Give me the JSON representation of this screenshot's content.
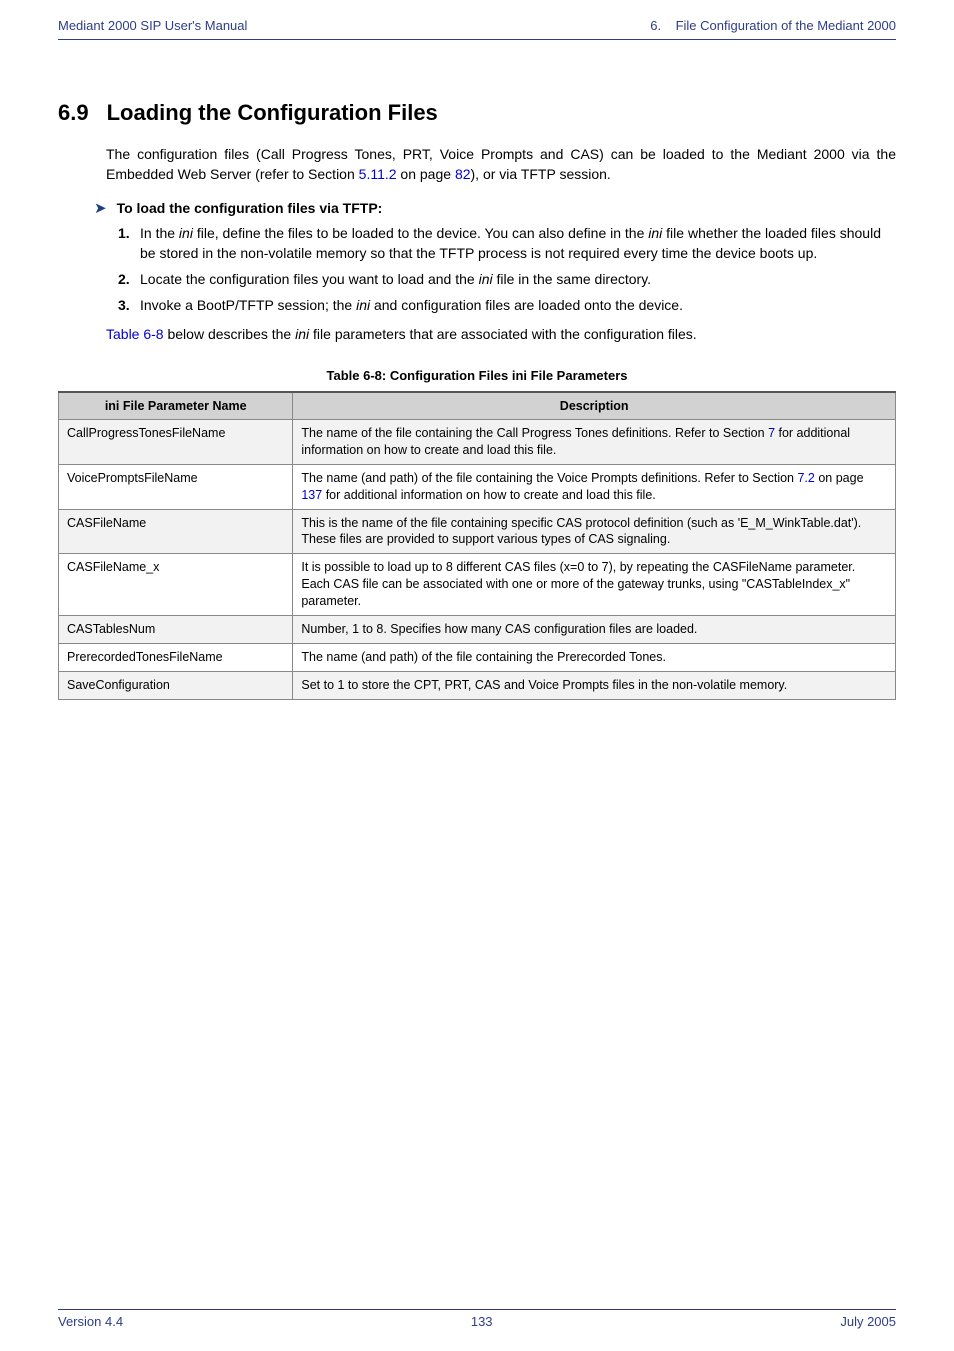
{
  "header": {
    "left": "Mediant 2000 SIP User's Manual",
    "right_prefix": "6.",
    "right_text": "File Configuration of the Mediant 2000"
  },
  "section": {
    "number": "6.9",
    "title": "Loading the Configuration Files"
  },
  "intro": {
    "p1a": "The configuration files (Call Progress Tones, PRT, Voice Prompts and CAS) can be loaded to the Mediant 2000 via the Embedded Web Server (refer to Section ",
    "link1": "5.11.2",
    "p1b": " on page ",
    "link2": "82",
    "p1c": "), or via TFTP session."
  },
  "steps": {
    "heading": "To load the configuration files via TFTP:",
    "s1a": "In the ",
    "ini": "ini",
    "s1b": " file, define the files to be loaded to the device. You can also define in the ",
    "s1c": " file whether the loaded files should be stored in the non-volatile memory so that the TFTP process is not required every time the device boots up.",
    "s2a": "Locate the configuration files you want to load and the ",
    "s2b": " file in the same directory.",
    "s3a": "Invoke a BootP/TFTP session; the ",
    "s3b": " and configuration files are loaded onto the device."
  },
  "after": {
    "a1": "Table 6-8",
    "a2": " below describes the ",
    "a3": " file parameters that are associated with the configuration files."
  },
  "table": {
    "caption": "Table 6-8: Configuration Files ini File Parameters",
    "col1": "ini File Parameter Name",
    "col2": "Description",
    "rows": [
      {
        "p": "CallProgressTonesFileName",
        "d_pre": "The name of the file containing the Call Progress Tones definitions. Refer to Section ",
        "d_link": "7",
        "d_post": " for additional information on how to create and load this file."
      },
      {
        "p": "VoicePromptsFileName",
        "d_pre": "The name (and path) of the file containing the Voice Prompts definitions. Refer to Section ",
        "d_link": "7.2",
        "d_mid": " on page ",
        "d_link2": "137",
        "d_post": " for additional information on how to create and load this file."
      },
      {
        "p": "CASFileName",
        "d": "This is the name of the file containing specific CAS protocol definition (such as 'E_M_WinkTable.dat'). These files are provided to support various types of CAS signaling."
      },
      {
        "p": "CASFileName_x",
        "d": "It is possible to load up to 8 different CAS files (x=0 to 7), by repeating the CASFileName parameter. Each CAS file can be associated with one or more of the gateway trunks, using \"CASTableIndex_x\" parameter."
      },
      {
        "p": "CASTablesNum",
        "d": "Number, 1 to 8. Specifies how many CAS configuration files are loaded."
      },
      {
        "p": "PrerecordedTonesFileName",
        "d": "The name (and path) of the file containing the Prerecorded Tones."
      },
      {
        "p": "SaveConfiguration",
        "d": "Set to 1 to store the CPT, PRT, CAS and Voice Prompts files in the non-volatile memory."
      }
    ]
  },
  "footer": {
    "left": "Version 4.4",
    "center": "133",
    "right": "July 2005"
  }
}
